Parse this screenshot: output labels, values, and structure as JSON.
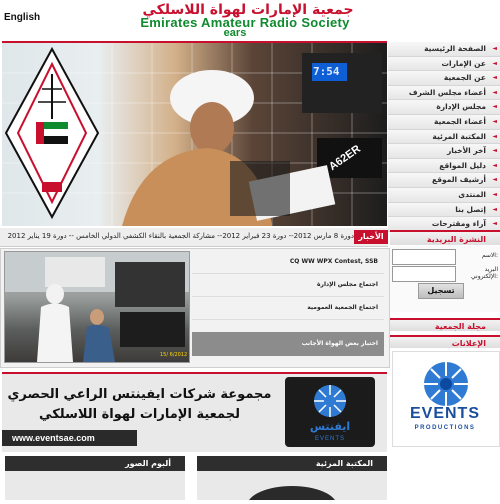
{
  "header": {
    "lang": "English",
    "title_ar": "جمعية الإمارات لهواة اللاسلكي",
    "title_en": "Emirates Amateur Radio Society",
    "short": "ears"
  },
  "banner": {
    "logo_text": "Emirates Amateur Radio Society",
    "radio_display": "7:54",
    "callsign": "A62ER"
  },
  "nav": {
    "items": [
      "الصفحة الرئيسية",
      "عن الإمارات",
      "عن الجمعية",
      "أعضاء مجلس الشرف",
      "مجلس الإدارة",
      "أعضاء الجمعية",
      "المكتبة المرئية",
      "آخر الأخبار",
      "دليل المواقع",
      "أرشيف الموقع",
      "المنتدى",
      "إتصل بنا",
      "آراء ومقترحات"
    ]
  },
  "ticker": {
    "label": "الأخبار",
    "text": "دورة 8 مارس 2012-- دورة 23 فبراير 2012-- مشاركة الجمعية بالنقاء الكشفي الدولي الخامس -- دورة 19 يناير 2012"
  },
  "news": {
    "photo_date": "15/ 6/2012",
    "links": [
      "CQ WW WPX Contest, SSB",
      "اجتماع مجلس الإدارة",
      "اجتماع الجمعية العمومية"
    ],
    "featured": "اختبار بعض الهواة الأجانب"
  },
  "mailing": {
    "title": "النشرة البريدية",
    "name_label": "الاسم:",
    "email_label": "البريد الإلكتروني:",
    "button": "تسجيل"
  },
  "magazine": {
    "title": "مجلة الجمعية"
  },
  "ads": {
    "title": "الإعلانات",
    "brand": "EVENTS",
    "sub": "PRODUCTIONS"
  },
  "sponsor": {
    "line1": "مجموعة شركات ايفينتس الراعي الحصري",
    "line2": "لجمعية الإمارات لهواة اللاسلكي",
    "url": "www.eventsae.com",
    "logo_ar": "ايفنتس",
    "logo_en": "EVENTS"
  },
  "bottom": {
    "gallery": "ألبوم الصور",
    "video": "المكتبة المرئية"
  },
  "colors": {
    "accent_red": "#c8102e",
    "accent_green": "#0f8a2e",
    "dark": "#2e2e2e"
  }
}
